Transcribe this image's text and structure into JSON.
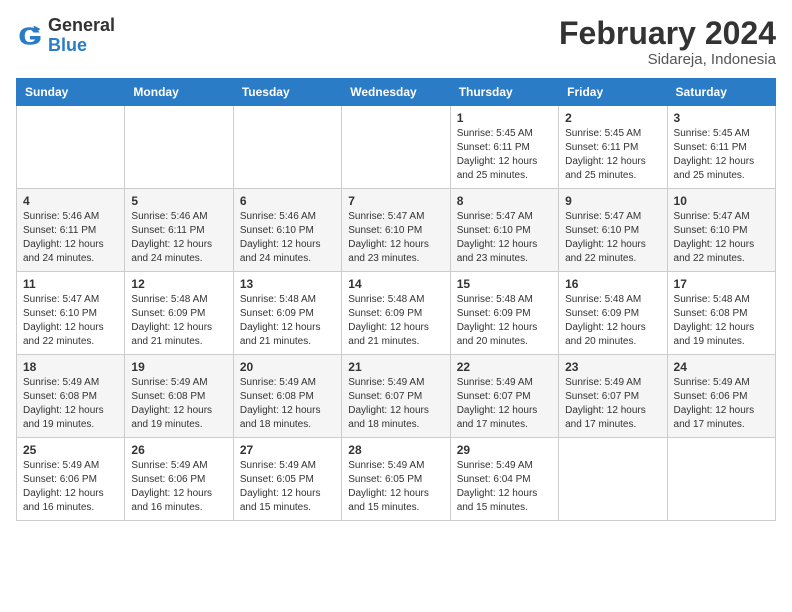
{
  "header": {
    "logo_general": "General",
    "logo_blue": "Blue",
    "month_year": "February 2024",
    "location": "Sidareja, Indonesia"
  },
  "days_of_week": [
    "Sunday",
    "Monday",
    "Tuesday",
    "Wednesday",
    "Thursday",
    "Friday",
    "Saturday"
  ],
  "weeks": [
    [
      {
        "day": "",
        "info": ""
      },
      {
        "day": "",
        "info": ""
      },
      {
        "day": "",
        "info": ""
      },
      {
        "day": "",
        "info": ""
      },
      {
        "day": "1",
        "info": "Sunrise: 5:45 AM\nSunset: 6:11 PM\nDaylight: 12 hours\nand 25 minutes."
      },
      {
        "day": "2",
        "info": "Sunrise: 5:45 AM\nSunset: 6:11 PM\nDaylight: 12 hours\nand 25 minutes."
      },
      {
        "day": "3",
        "info": "Sunrise: 5:45 AM\nSunset: 6:11 PM\nDaylight: 12 hours\nand 25 minutes."
      }
    ],
    [
      {
        "day": "4",
        "info": "Sunrise: 5:46 AM\nSunset: 6:11 PM\nDaylight: 12 hours\nand 24 minutes."
      },
      {
        "day": "5",
        "info": "Sunrise: 5:46 AM\nSunset: 6:11 PM\nDaylight: 12 hours\nand 24 minutes."
      },
      {
        "day": "6",
        "info": "Sunrise: 5:46 AM\nSunset: 6:10 PM\nDaylight: 12 hours\nand 24 minutes."
      },
      {
        "day": "7",
        "info": "Sunrise: 5:47 AM\nSunset: 6:10 PM\nDaylight: 12 hours\nand 23 minutes."
      },
      {
        "day": "8",
        "info": "Sunrise: 5:47 AM\nSunset: 6:10 PM\nDaylight: 12 hours\nand 23 minutes."
      },
      {
        "day": "9",
        "info": "Sunrise: 5:47 AM\nSunset: 6:10 PM\nDaylight: 12 hours\nand 22 minutes."
      },
      {
        "day": "10",
        "info": "Sunrise: 5:47 AM\nSunset: 6:10 PM\nDaylight: 12 hours\nand 22 minutes."
      }
    ],
    [
      {
        "day": "11",
        "info": "Sunrise: 5:47 AM\nSunset: 6:10 PM\nDaylight: 12 hours\nand 22 minutes."
      },
      {
        "day": "12",
        "info": "Sunrise: 5:48 AM\nSunset: 6:09 PM\nDaylight: 12 hours\nand 21 minutes."
      },
      {
        "day": "13",
        "info": "Sunrise: 5:48 AM\nSunset: 6:09 PM\nDaylight: 12 hours\nand 21 minutes."
      },
      {
        "day": "14",
        "info": "Sunrise: 5:48 AM\nSunset: 6:09 PM\nDaylight: 12 hours\nand 21 minutes."
      },
      {
        "day": "15",
        "info": "Sunrise: 5:48 AM\nSunset: 6:09 PM\nDaylight: 12 hours\nand 20 minutes."
      },
      {
        "day": "16",
        "info": "Sunrise: 5:48 AM\nSunset: 6:09 PM\nDaylight: 12 hours\nand 20 minutes."
      },
      {
        "day": "17",
        "info": "Sunrise: 5:48 AM\nSunset: 6:08 PM\nDaylight: 12 hours\nand 19 minutes."
      }
    ],
    [
      {
        "day": "18",
        "info": "Sunrise: 5:49 AM\nSunset: 6:08 PM\nDaylight: 12 hours\nand 19 minutes."
      },
      {
        "day": "19",
        "info": "Sunrise: 5:49 AM\nSunset: 6:08 PM\nDaylight: 12 hours\nand 19 minutes."
      },
      {
        "day": "20",
        "info": "Sunrise: 5:49 AM\nSunset: 6:08 PM\nDaylight: 12 hours\nand 18 minutes."
      },
      {
        "day": "21",
        "info": "Sunrise: 5:49 AM\nSunset: 6:07 PM\nDaylight: 12 hours\nand 18 minutes."
      },
      {
        "day": "22",
        "info": "Sunrise: 5:49 AM\nSunset: 6:07 PM\nDaylight: 12 hours\nand 17 minutes."
      },
      {
        "day": "23",
        "info": "Sunrise: 5:49 AM\nSunset: 6:07 PM\nDaylight: 12 hours\nand 17 minutes."
      },
      {
        "day": "24",
        "info": "Sunrise: 5:49 AM\nSunset: 6:06 PM\nDaylight: 12 hours\nand 17 minutes."
      }
    ],
    [
      {
        "day": "25",
        "info": "Sunrise: 5:49 AM\nSunset: 6:06 PM\nDaylight: 12 hours\nand 16 minutes."
      },
      {
        "day": "26",
        "info": "Sunrise: 5:49 AM\nSunset: 6:06 PM\nDaylight: 12 hours\nand 16 minutes."
      },
      {
        "day": "27",
        "info": "Sunrise: 5:49 AM\nSunset: 6:05 PM\nDaylight: 12 hours\nand 15 minutes."
      },
      {
        "day": "28",
        "info": "Sunrise: 5:49 AM\nSunset: 6:05 PM\nDaylight: 12 hours\nand 15 minutes."
      },
      {
        "day": "29",
        "info": "Sunrise: 5:49 AM\nSunset: 6:04 PM\nDaylight: 12 hours\nand 15 minutes."
      },
      {
        "day": "",
        "info": ""
      },
      {
        "day": "",
        "info": ""
      }
    ]
  ]
}
